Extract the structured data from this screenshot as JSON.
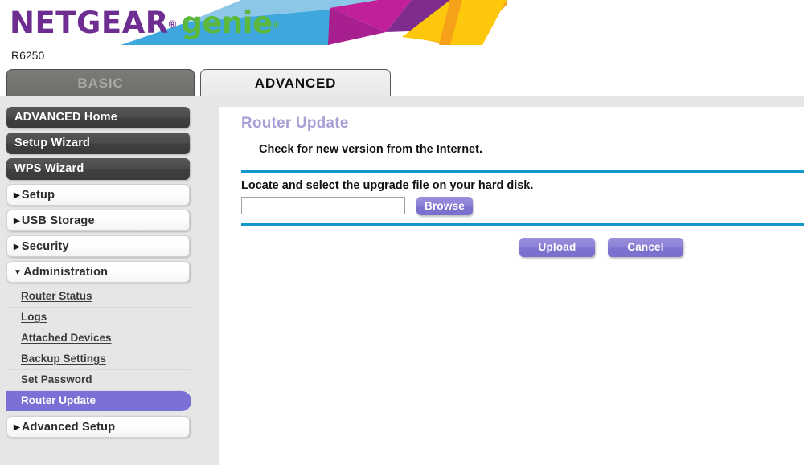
{
  "brand": {
    "netgear": "NETGEAR",
    "registered_mark": "®",
    "genie": "genie",
    "genie_mark": "®",
    "model": "R6250",
    "colors": {
      "netgear_purple": "#6d2d91",
      "genie_green": "#5cb83c",
      "accent_blue": "#1298cd",
      "button_purple": "#8d82d6",
      "active_nav_purple": "#7b70d6",
      "title_purple": "#a79fd6"
    }
  },
  "tabs": [
    {
      "label": "BASIC",
      "active": false
    },
    {
      "label": "ADVANCED",
      "active": true
    }
  ],
  "sidebar": {
    "primary": [
      {
        "label": "ADVANCED Home",
        "style": "dark",
        "arrow": ""
      },
      {
        "label": "Setup Wizard",
        "style": "dark",
        "arrow": ""
      },
      {
        "label": "WPS Wizard",
        "style": "dark",
        "arrow": ""
      },
      {
        "label": "Setup",
        "style": "light",
        "arrow": "▶"
      },
      {
        "label": "USB Storage",
        "style": "light",
        "arrow": "▶"
      },
      {
        "label": "Security",
        "style": "light",
        "arrow": "▶"
      },
      {
        "label": "Administration",
        "style": "light",
        "arrow": "▼",
        "expanded": true
      }
    ],
    "submenu": [
      {
        "label": "Router Status",
        "active": false
      },
      {
        "label": "Logs",
        "active": false
      },
      {
        "label": "Attached Devices",
        "active": false
      },
      {
        "label": "Backup Settings",
        "active": false
      },
      {
        "label": "Set Password",
        "active": false
      },
      {
        "label": "Router Update",
        "active": true
      }
    ],
    "after_submenu": [
      {
        "label": "Advanced Setup",
        "style": "light",
        "arrow": "▶"
      }
    ]
  },
  "main": {
    "title": "Router Update",
    "check_text": "Check for new version from the Internet.",
    "locate_text": "Locate and select the upgrade file on your hard disk.",
    "file_field": {
      "value": "",
      "placeholder": ""
    },
    "browse_label": "Browse",
    "upload_label": "Upload",
    "cancel_label": "Cancel"
  }
}
